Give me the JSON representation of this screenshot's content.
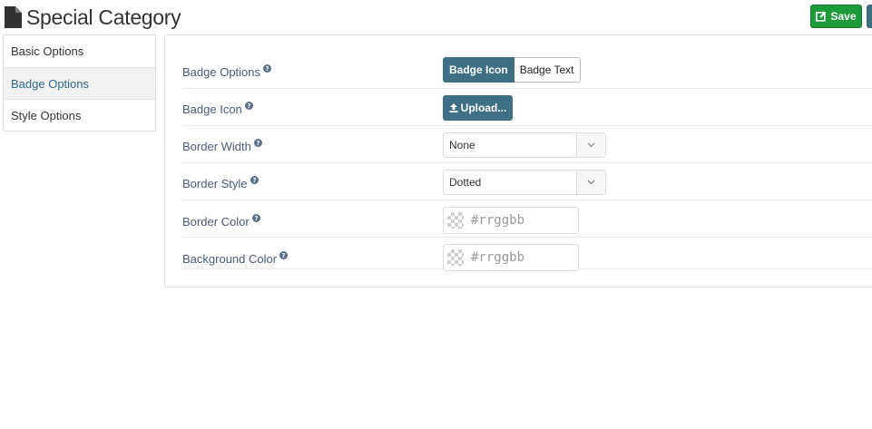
{
  "header": {
    "title": "Special Category",
    "icon": "document-icon",
    "save_label": "Save",
    "save_color": "#1d9a3a"
  },
  "sidebar": {
    "items": [
      {
        "label": "Basic Options",
        "active": false
      },
      {
        "label": "Badge Options",
        "active": true
      },
      {
        "label": "Style Options",
        "active": false
      }
    ]
  },
  "form": {
    "badge_options": {
      "label": "Badge Options",
      "options": [
        "Badge Icon",
        "Badge Text"
      ],
      "selected": "Badge Icon"
    },
    "badge_icon": {
      "label": "Badge Icon",
      "button_label": "Upload..."
    },
    "border_width": {
      "label": "Border Width",
      "value": "None"
    },
    "border_style": {
      "label": "Border Style",
      "value": "Dotted"
    },
    "border_color": {
      "label": "Border Color",
      "placeholder": "#rrggbb"
    },
    "background_color": {
      "label": "Background Color",
      "placeholder": "#rrggbb"
    }
  },
  "colors": {
    "accent": "#3e6f84",
    "label_text": "#4a5a78"
  }
}
